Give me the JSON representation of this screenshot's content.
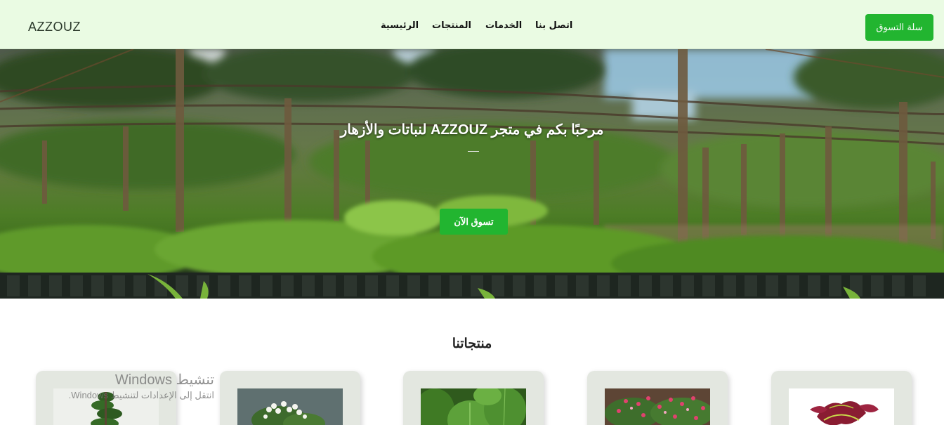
{
  "header": {
    "logo": "AZZOUZ",
    "nav": {
      "home": "الرئيسية",
      "products": "المنتجات",
      "services": "الخدمات",
      "contact": "اتصل بنا"
    },
    "cart_label": "سلة التسوق"
  },
  "hero": {
    "title": "مرحبًا بكم في متجر AZZOUZ لنباتات والأزهار",
    "button_label": "تسوق الآن"
  },
  "products": {
    "title": "منتجاتنا",
    "items": [
      {
        "image": "coleus-plant-image"
      },
      {
        "image": "pink-flowers-image"
      },
      {
        "image": "large-leaf-plant-image"
      },
      {
        "image": "white-flowers-image"
      },
      {
        "image": "bonsai-plant-image"
      }
    ]
  },
  "watermark": {
    "line1": "تنشيط Windows",
    "line2": "انتقل إلى الإعدادات لتنشيط Windows."
  },
  "colors": {
    "header_bg": "#eafbe3",
    "accent": "#22b530",
    "card_bg": "#e3e7e0"
  }
}
